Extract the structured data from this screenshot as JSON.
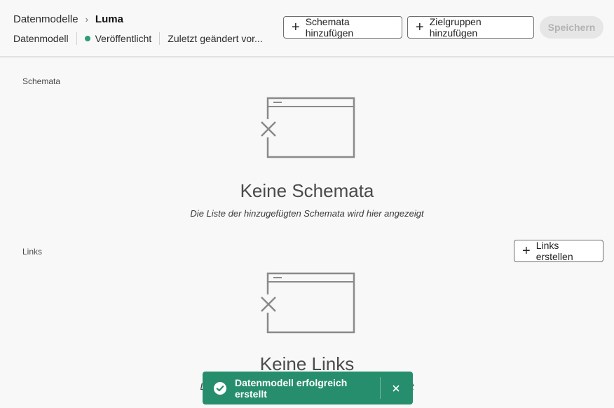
{
  "header": {
    "breadcrumb_parent": "Datenmodelle",
    "breadcrumb_current": "Luma",
    "meta_model": "Datenmodell",
    "meta_status": "Veröffentlicht",
    "meta_modified": "Zuletzt geändert vor...",
    "add_schemas_label": "Schemata hinzufügen",
    "add_audiences_label": "Zielgruppen hinzufügen",
    "save_label": "Speichern"
  },
  "schemas_section": {
    "label": "Schemata",
    "empty_title": "Keine Schemata",
    "empty_desc": "Die Liste der hinzugefügten Schemata wird hier angezeigt"
  },
  "links_section": {
    "label": "Links",
    "create_links_label": "Links erstellen",
    "empty_title": "Keine Links",
    "empty_desc": "Die Liste der hinzugefügten Links wird hier angezeigt"
  },
  "toast": {
    "message": "Datenmodell erfolgreich erstellt"
  },
  "colors": {
    "status_published": "#2d9d78",
    "toast_bg": "#268e6c"
  }
}
